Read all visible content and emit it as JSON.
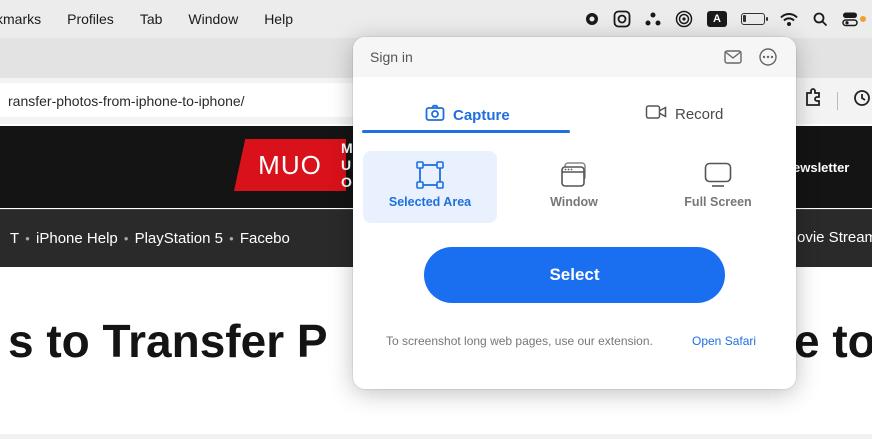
{
  "menubar": {
    "items": [
      "kmarks",
      "Profiles",
      "Tab",
      "Window",
      "Help"
    ],
    "status_icons": [
      "record-icon",
      "screenshot-app-icon",
      "dots-icon",
      "airdrop-icon",
      "input-source-icon",
      "battery-icon",
      "wifi-icon",
      "spotlight-icon",
      "control-center-icon"
    ],
    "input_source_label": "A"
  },
  "browser": {
    "url": "ransfer-photos-from-iphone-to-iphone/"
  },
  "site": {
    "logo_text": "MUO",
    "logo_side_text": "M\nU\nO",
    "newsletter": "ewsletter",
    "nav_links": [
      "T",
      "iPhone Help",
      "PlayStation 5",
      "Facebo"
    ],
    "nav_right": "ovie Stream",
    "headline_left": "s to Transfer P",
    "headline_right": "e to"
  },
  "popup": {
    "signin": "Sign in",
    "tabs": {
      "capture": "Capture",
      "record": "Record"
    },
    "modes": {
      "selected_area": "Selected Area",
      "window": "Window",
      "full_screen": "Full Screen"
    },
    "select_button": "Select",
    "footer_note": "To screenshot long web pages, use our extension.",
    "footer_link": "Open Safari"
  },
  "colors": {
    "accent": "#1f6fe0",
    "button": "#1a6ff0",
    "site_header": "#141414",
    "logo_red": "#d9111a"
  }
}
